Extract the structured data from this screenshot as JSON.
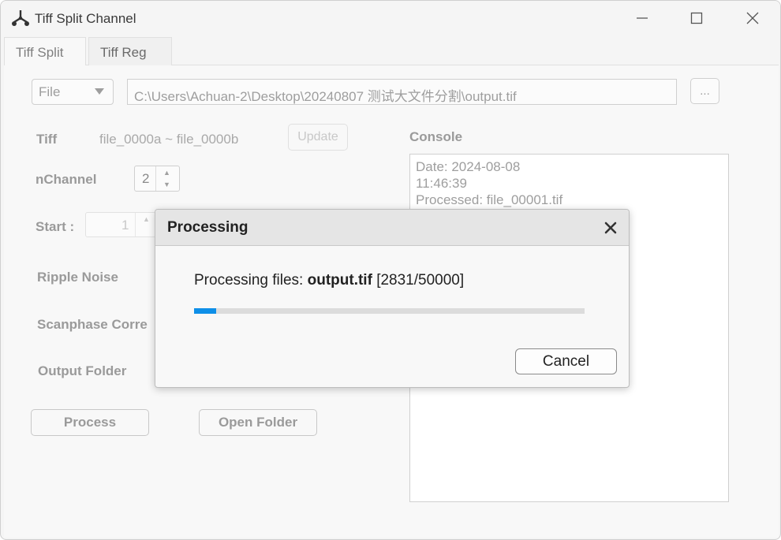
{
  "window": {
    "title": "Tiff Split Channel"
  },
  "tabs": [
    {
      "label": "Tiff Split",
      "active": true
    },
    {
      "label": "Tiff Reg",
      "active": false
    }
  ],
  "source": {
    "type_selected": "File",
    "path": "C:\\Users\\Achuan-2\\Desktop\\20240807 测试大文件分割\\output.tif",
    "browse_label": "..."
  },
  "form": {
    "tiff_label": "Tiff",
    "tiff_range": "file_0000a ~ file_0000b",
    "update_label": "Update",
    "nchannel_label": "nChannel",
    "nchannel_value": "2",
    "start_label": "Start :",
    "start_value": "1",
    "ripple_label": "Ripple Noise",
    "scanphase_label": "Scanphase Corre",
    "output_label": "Output Folder",
    "process_label": "Process",
    "open_folder_label": "Open Folder"
  },
  "console": {
    "label": "Console",
    "lines": [
      "Date: 2024-08-08",
      "11:46:39",
      "Processed: file_00001.tif"
    ]
  },
  "dialog": {
    "title": "Processing",
    "message_prefix": "Processing files: ",
    "filename": "output.tif",
    "counter": " [2831/50000]",
    "progress": 0.0566,
    "cancel_label": "Cancel"
  },
  "colors": {
    "progress_fill": "#0e8fe8",
    "progress_track": "#dcdcdc"
  }
}
